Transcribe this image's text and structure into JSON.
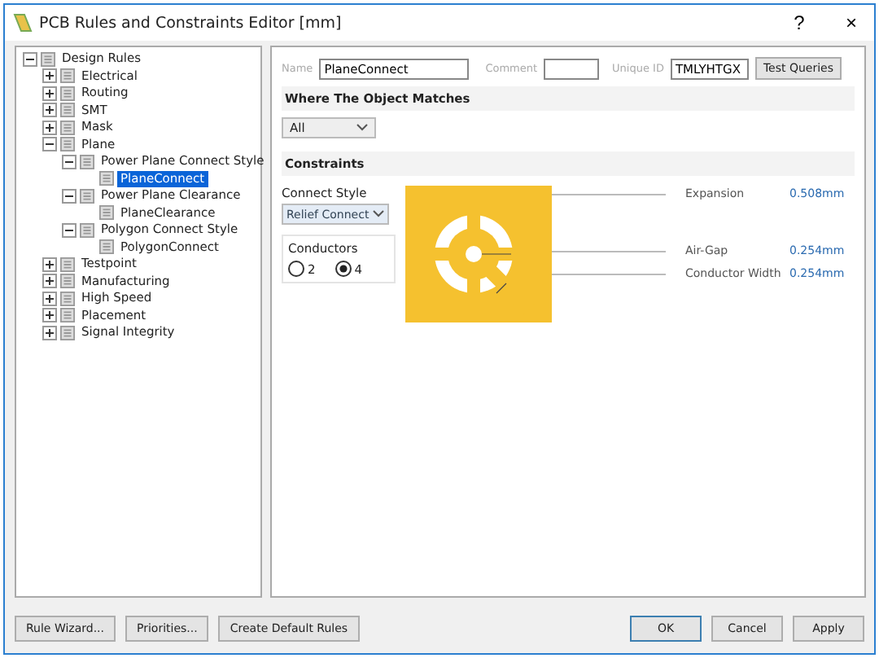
{
  "window": {
    "title": "PCB Rules and Constraints Editor [mm]",
    "help": "?",
    "close": "×"
  },
  "tree": [
    {
      "label": "Design Rules",
      "expanded": true,
      "selected": false,
      "children": [
        {
          "label": "Electrical",
          "expanded": false,
          "selected": false
        },
        {
          "label": "Routing",
          "expanded": false,
          "selected": false
        },
        {
          "label": "SMT",
          "expanded": false,
          "selected": false
        },
        {
          "label": "Mask",
          "expanded": false,
          "selected": false
        },
        {
          "label": "Plane",
          "expanded": true,
          "selected": false,
          "children": [
            {
              "label": "Power Plane Connect Style",
              "expanded": true,
              "selected": false,
              "children": [
                {
                  "label": "PlaneConnect",
                  "selected": true
                }
              ]
            },
            {
              "label": "Power Plane Clearance",
              "expanded": true,
              "selected": false,
              "children": [
                {
                  "label": "PlaneClearance",
                  "selected": false
                }
              ]
            },
            {
              "label": "Polygon Connect Style",
              "expanded": true,
              "selected": false,
              "children": [
                {
                  "label": "PolygonConnect",
                  "selected": false
                }
              ]
            }
          ]
        },
        {
          "label": "Testpoint",
          "expanded": false,
          "selected": false
        },
        {
          "label": "Manufacturing",
          "expanded": false,
          "selected": false
        },
        {
          "label": "High Speed",
          "expanded": false,
          "selected": false
        },
        {
          "label": "Placement",
          "expanded": false,
          "selected": false
        },
        {
          "label": "Signal Integrity",
          "expanded": false,
          "selected": false
        }
      ]
    }
  ],
  "rule": {
    "name_label": "Name",
    "name": "PlaneConnect",
    "comment_label": "Comment",
    "uid_label": "Unique ID",
    "uid": "TMLYHTGX",
    "test_button": "Test Queries"
  },
  "where": {
    "title": "Where The Object Matches",
    "scope": "All"
  },
  "constraints": {
    "title": "Constraints",
    "connect_style_label": "Connect Style",
    "connect_style": "Relief Connect",
    "conductors_label": "Conductors",
    "conductors": [
      {
        "label": "2",
        "selected": false
      },
      {
        "label": "4",
        "selected": true
      }
    ],
    "params": [
      {
        "label": "Expansion",
        "value": "0.508mm"
      },
      {
        "label": "Air-Gap",
        "value": "0.254mm"
      },
      {
        "label": "Conductor Width",
        "value": "0.254mm"
      }
    ]
  },
  "left_buttons": [
    "Rule Wizard...",
    "Priorities...",
    "Create Default Rules"
  ],
  "right_buttons": [
    "OK",
    "Cancel",
    "Apply"
  ]
}
